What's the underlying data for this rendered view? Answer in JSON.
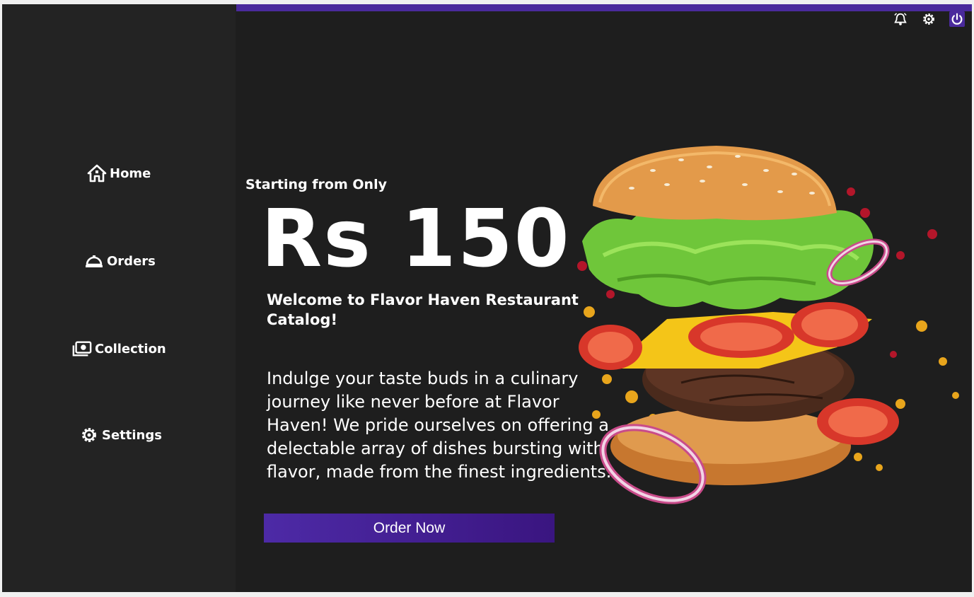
{
  "sidebar": {
    "items": [
      {
        "label": "Home",
        "icon": "home-icon"
      },
      {
        "label": "Orders",
        "icon": "cloche-icon"
      },
      {
        "label": "Collection",
        "icon": "money-icon"
      },
      {
        "label": "Settings",
        "icon": "gear-icon"
      }
    ]
  },
  "header": {
    "icons": [
      "bell-icon",
      "gear-icon",
      "power-icon"
    ],
    "accent_color": "#4a2a9c"
  },
  "hero": {
    "starting_text": "Starting from Only",
    "price": "Rs 150",
    "welcome": "Welcome to Flavor Haven Restaurant Catalog!",
    "description": "Indulge your taste buds in a culinary journey like never before at Flavor Haven! We pride ourselves on offering a delectable array of dishes bursting with flavor, made from the finest ingredients.",
    "order_button": "Order Now"
  }
}
